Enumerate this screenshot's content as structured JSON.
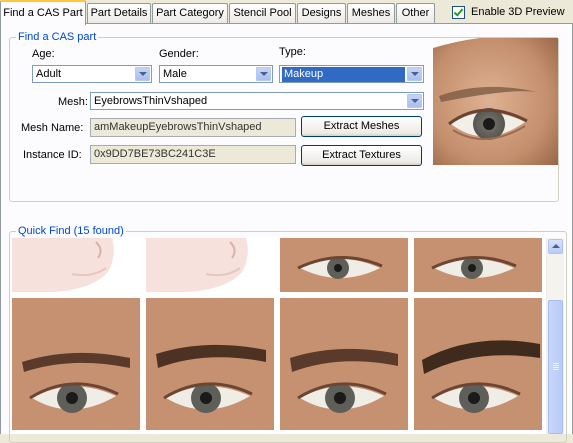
{
  "tabs": [
    {
      "label": "Find a CAS Part",
      "active": true
    },
    {
      "label": "Part Details",
      "active": false
    },
    {
      "label": "Part Category",
      "active": false
    },
    {
      "label": "Stencil Pool",
      "active": false
    },
    {
      "label": "Designs",
      "active": false
    },
    {
      "label": "Meshes",
      "active": false
    },
    {
      "label": "Other",
      "active": false
    }
  ],
  "preview_toggle": {
    "label": "Enable 3D Preview",
    "checked": true
  },
  "find_group": {
    "legend": "Find a CAS part",
    "age": {
      "label": "Age:",
      "value": "Adult"
    },
    "gender": {
      "label": "Gender:",
      "value": "Male"
    },
    "type": {
      "label": "Type:",
      "value": "Makeup"
    },
    "mesh": {
      "label": "Mesh:",
      "value": "EyebrowsThinVshaped"
    },
    "mesh_name": {
      "label": "Mesh Name:",
      "value": "amMakeupEyebrowsThinVshaped"
    },
    "instance_id": {
      "label": "Instance ID:",
      "value": "0x9DD7BE73BC241C3E"
    },
    "extract_meshes": "Extract Meshes",
    "extract_textures": "Extract Textures"
  },
  "quick_find": {
    "legend": "Quick Find (15 found)",
    "thumbnails": [
      {
        "name": "thumb-jaw-1",
        "kind": "jaw"
      },
      {
        "name": "thumb-jaw-2",
        "kind": "jaw"
      },
      {
        "name": "thumb-eye-1",
        "kind": "eye"
      },
      {
        "name": "thumb-eye-2",
        "kind": "eye"
      },
      {
        "name": "thumb-brow-1",
        "kind": "brow"
      },
      {
        "name": "thumb-brow-2",
        "kind": "brow"
      },
      {
        "name": "thumb-brow-3",
        "kind": "brow"
      },
      {
        "name": "thumb-brow-4",
        "kind": "brow"
      }
    ]
  },
  "colors": {
    "window_bg": "#ece9d8",
    "panel_bg": "#fcfcfe",
    "group_legend": "#0046d5",
    "selection": "#316ac5",
    "skin": "#c99a78"
  }
}
